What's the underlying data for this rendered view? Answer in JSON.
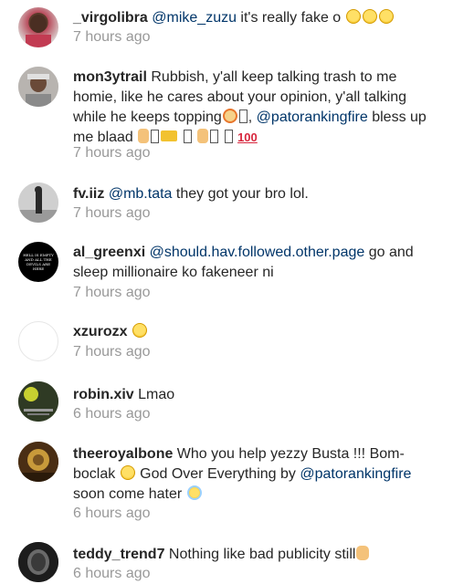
{
  "comments": [
    {
      "user": "_virgolibra",
      "mention": "@mike_zuzu",
      "text": " it's really fake o ",
      "time": "7 hours ago"
    },
    {
      "user": "mon3ytrail",
      "text_1": " Rubbish,  y'all keep talking trash to me homie, like he cares about your opinion, y'all talking while he  keeps topping",
      "mention": "@patorankingfire",
      "text_2": " bless up me blaad ",
      "time": "7 hours ago"
    },
    {
      "user": "fv.iiz",
      "mention": "@mb.tata",
      "text": " they got your bro lol.",
      "time": "7 hours ago"
    },
    {
      "user": "al_greenxi",
      "mention": "@should.hav.followed.other.page",
      "text": " go and sleep millionaire ko fakeneer ni",
      "time": "7 hours ago",
      "avatar_text": "HELL IS EMPTY AND ALL THE DEVILS ARE HERE"
    },
    {
      "user": "xzurozx",
      "text": " ",
      "time": "7 hours ago"
    },
    {
      "user": "robin.xiv",
      "text": " Lmao",
      "time": "6 hours ago"
    },
    {
      "user": "theeroyalbone",
      "text_1": " Who you help yezzy Busta !!! Bom-boclak ",
      "text_2": " God Over Everything by ",
      "mention": "@patorankingfire",
      "text_3": " soon come hater ",
      "time": "6 hours ago"
    },
    {
      "user": "teddy_trend7",
      "text": " Nothing like bad publicity still",
      "time": "6 hours ago"
    }
  ]
}
